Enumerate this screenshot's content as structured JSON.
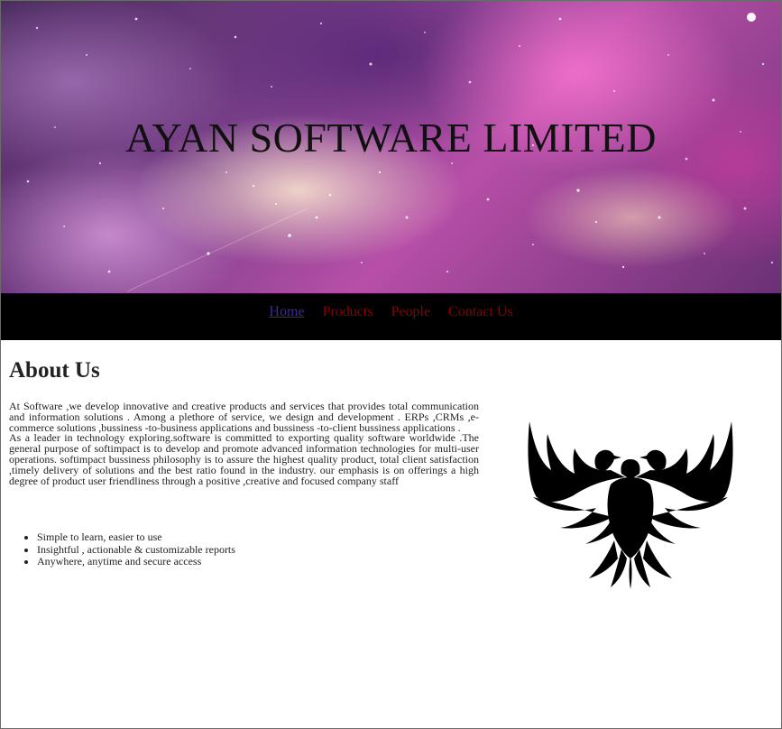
{
  "banner": {
    "title": "AYAN SOFTWARE LIMITED"
  },
  "nav": {
    "items": [
      {
        "label": "Home",
        "active": true
      },
      {
        "label": "Products"
      },
      {
        "label": "People"
      },
      {
        "label": "Contact Us"
      }
    ]
  },
  "about": {
    "heading": "About Us",
    "paragraph1": "At Software ,we develop innovative and creative products and services that provides total communication and information solutions . Among a plethore of service, we design and development . ERPs ,CRMs ,e-commerce solutions ,bussiness -to-business applications and bussiness -to-client bussiness applications .",
    "paragraph2": "As a leader in technology exploring.software is committed to exporting quality software worldwide .The general purpose of softimpact is to develop and promote advanced information technologies for multi-user operations. softimpact bussiness philosophy is to assure the highest quality product, total client satisfaction ,timely delivery of solutions and the best ratio found in the industry. our emphasis is on offerings a high degree of product user friendliness through a positive ,creative and focused company staff",
    "features": [
      "Simple to learn, easier to use",
      "Insightful , actionable & customizable reports",
      "Anywhere, anytime and secure access"
    ]
  },
  "logo": {
    "icon": "eagle-logo-icon",
    "color": "#000000"
  },
  "colors": {
    "nav_background": "#000000",
    "nav_link": "#8b0000",
    "nav_link_active": "#3a2b95"
  }
}
